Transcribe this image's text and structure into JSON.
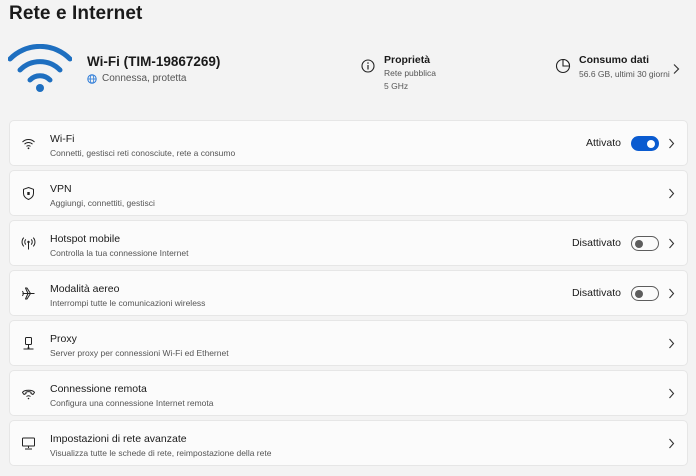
{
  "page": {
    "title": "Rete e Internet"
  },
  "hero": {
    "icon": "wifi-signal-icon",
    "network_name": "Wi-Fi (TIM-19867269)",
    "status": "Connessa, protetta",
    "properties": {
      "title": "Proprietà",
      "line1": "Rete pubblica",
      "line2": "5 GHz",
      "icon": "info-icon"
    },
    "data_usage": {
      "title": "Consumo dati",
      "detail": "56.6 GB, ultimi 30 giorni",
      "icon": "data-usage-icon"
    }
  },
  "accent_color": "#0a5bd0",
  "rows": [
    {
      "title": "Wi-Fi",
      "subtitle": "Connetti, gestisci reti conosciute, rete a consumo",
      "state": "Attivato",
      "toggle": true,
      "icon": "wifi-icon"
    },
    {
      "title": "VPN",
      "subtitle": "Aggiungi, connettiti, gestisci",
      "icon": "shield-icon"
    },
    {
      "title": "Hotspot mobile",
      "subtitle": "Controlla la tua connessione Internet",
      "state": "Disattivato",
      "toggle": false,
      "icon": "hotspot-icon"
    },
    {
      "title": "Modalità aereo",
      "subtitle": "Interrompi tutte le comunicazioni wireless",
      "state": "Disattivato",
      "toggle": false,
      "icon": "airplane-icon"
    },
    {
      "title": "Proxy",
      "subtitle": "Server proxy per connessioni Wi-Fi ed Ethernet",
      "icon": "proxy-icon"
    },
    {
      "title": "Connessione remota",
      "subtitle": "Configura una connessione Internet remota",
      "icon": "dialup-icon"
    },
    {
      "title": "Impostazioni di rete avanzate",
      "subtitle": "Visualizza tutte le schede di rete, reimpostazione della rete",
      "icon": "network-monitor-icon"
    }
  ]
}
